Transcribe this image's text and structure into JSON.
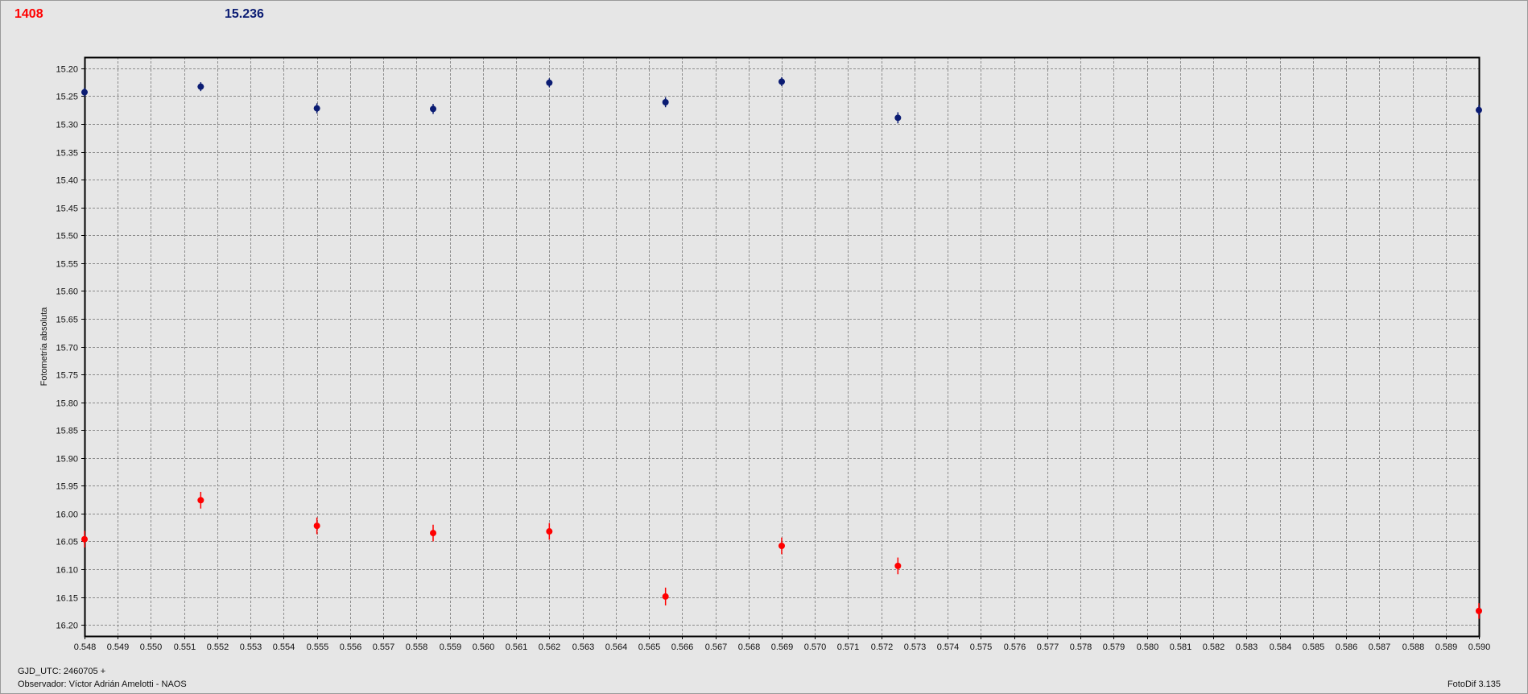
{
  "header": {
    "red_value": "1408",
    "blue_value": "15.236"
  },
  "footer": {
    "gjd": "GJD_UTC: 2460705 +",
    "observer": "Observador: Víctor Adrián Amelotti - NAOS",
    "software": "FotoDif 3.135"
  },
  "colors": {
    "red_series": "#ff0000",
    "blue_series": "#0b1c73",
    "background": "#e6e6e6",
    "grid": "#8c8c8c"
  },
  "chart_data": {
    "type": "scatter",
    "ylabel": "Fotometría absoluta",
    "xlim": [
      0.548,
      0.59
    ],
    "ylim": [
      15.18,
      16.22
    ],
    "y_inverted": true,
    "grid": true,
    "x_ticks": [
      "0.548",
      "0.549",
      "0.550",
      "0.551",
      "0.552",
      "0.553",
      "0.554",
      "0.555",
      "0.556",
      "0.557",
      "0.558",
      "0.559",
      "0.560",
      "0.561",
      "0.562",
      "0.563",
      "0.564",
      "0.565",
      "0.566",
      "0.567",
      "0.568",
      "0.569",
      "0.570",
      "0.571",
      "0.572",
      "0.573",
      "0.574",
      "0.575",
      "0.576",
      "0.577",
      "0.578",
      "0.579",
      "0.580",
      "0.581",
      "0.582",
      "0.583",
      "0.584",
      "0.585",
      "0.586",
      "0.587",
      "0.588",
      "0.589",
      "0.590"
    ],
    "y_ticks": [
      "15.20",
      "15.25",
      "15.30",
      "15.35",
      "15.40",
      "15.45",
      "15.50",
      "15.55",
      "15.60",
      "15.65",
      "15.70",
      "15.75",
      "15.80",
      "15.85",
      "15.90",
      "15.95",
      "16.00",
      "16.05",
      "16.10",
      "16.15",
      "16.20"
    ],
    "series": [
      {
        "color": "#0b1c73",
        "x": [
          0.548,
          0.5515,
          0.555,
          0.5585,
          0.562,
          0.5655,
          0.569,
          0.5725,
          0.59
        ],
        "y": [
          15.243,
          15.233,
          15.272,
          15.273,
          15.226,
          15.261,
          15.224,
          15.289,
          15.275
        ],
        "err": [
          0.008,
          0.008,
          0.009,
          0.009,
          0.008,
          0.009,
          0.008,
          0.01,
          0.009
        ]
      },
      {
        "color": "#ff0000",
        "x": [
          0.548,
          0.5515,
          0.555,
          0.5585,
          0.562,
          0.5655,
          0.569,
          0.5725,
          0.59
        ],
        "y": [
          16.046,
          15.976,
          16.022,
          16.035,
          16.032,
          16.149,
          16.058,
          16.094,
          16.175
        ],
        "err": [
          0.015,
          0.015,
          0.015,
          0.015,
          0.015,
          0.016,
          0.015,
          0.015,
          0.014
        ]
      }
    ]
  }
}
